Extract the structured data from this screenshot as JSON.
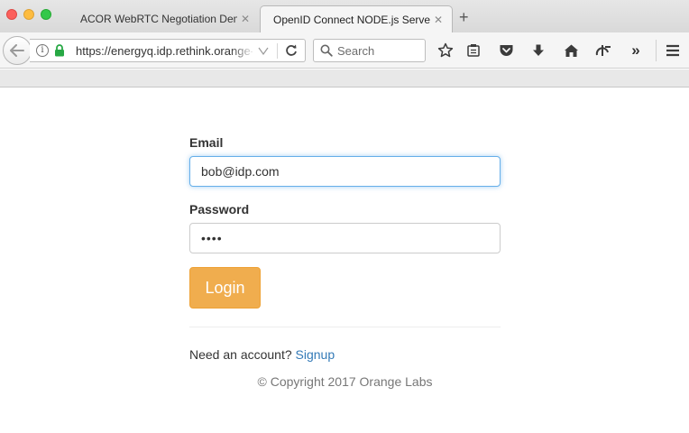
{
  "browser": {
    "tabs": [
      {
        "title": "ACOR WebRTC Negotiation Demo",
        "active": false
      },
      {
        "title": "OpenID Connect NODE.js Server",
        "active": true
      }
    ],
    "new_tab": "+",
    "tab_close": "✕",
    "url": "https://energyq.idp.rethink.orange-labs.fr",
    "search_placeholder": "Search",
    "info_glyph": "i",
    "overflow_glyph": "»",
    "icons": [
      "back-arrow-icon",
      "info-icon",
      "lock-icon",
      "dropdown-icon",
      "reload-icon",
      "search-icon",
      "bookmark-star-icon",
      "reading-list-icon",
      "pocket-icon",
      "download-icon",
      "home-icon",
      "webrtc-icon",
      "overflow-icon",
      "hamburger-menu-icon"
    ],
    "accent_secure": "#27a844"
  },
  "login_form": {
    "email_label": "Email",
    "email_value": "bob@idp.com",
    "password_label": "Password",
    "password_value": "••••",
    "login_button": "Login",
    "login_color": "#f0ad4e",
    "need_account": "Need an account?",
    "signup_link": "Signup",
    "link_color": "#337ab7",
    "copyright": "© Copyright 2017 Orange Labs"
  }
}
